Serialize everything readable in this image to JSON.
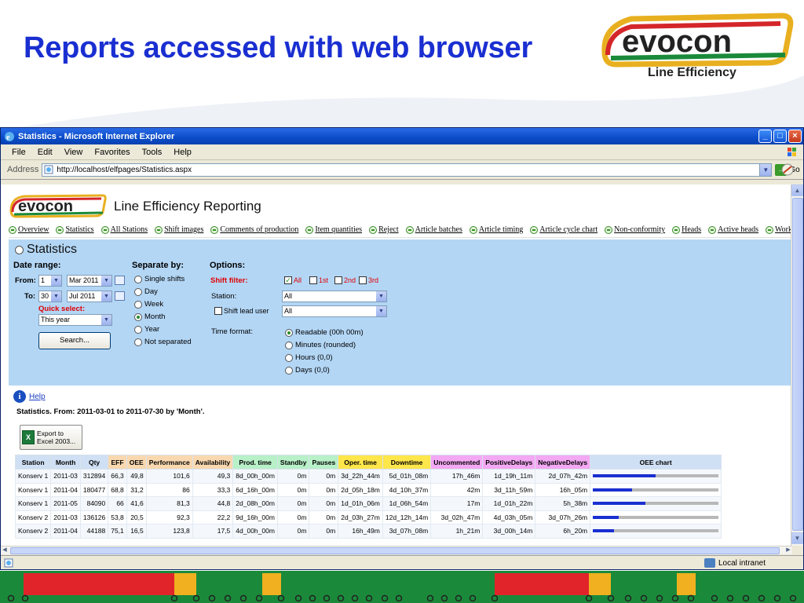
{
  "slide": {
    "title": "Reports accessed with web browser",
    "brand": "evocon",
    "tagline": "Line Efficiency"
  },
  "browser": {
    "window_title": "Statistics - Microsoft Internet Explorer",
    "menu": [
      "File",
      "Edit",
      "View",
      "Favorites",
      "Tools",
      "Help"
    ],
    "address_label": "Address",
    "url": "http://localhost/elfpages/Statistics.aspx",
    "go_label": "Go",
    "status_zone": "Local intranet"
  },
  "app": {
    "brand": "evocon",
    "title": "Line Efficiency Reporting",
    "nav": [
      "Overview",
      "Statistics",
      "All Stations",
      "Shift images",
      "Comments of production",
      "Item quantities",
      "Reject",
      "Article batches",
      "Article timing",
      "Article cycle chart",
      "Non-conformity",
      "Heads",
      "Active heads",
      "Working tim"
    ]
  },
  "stats": {
    "heading": "Statistics",
    "date_range": {
      "label": "Date range:",
      "from_label": "From:",
      "from_day": "1",
      "from_month": "Mar 2011",
      "to_label": "To:",
      "to_day": "30",
      "to_month": "Jul 2011",
      "quick_label": "Quick select:",
      "quick_value": "This year",
      "search_label": "Search..."
    },
    "separate": {
      "label": "Separate by:",
      "options": [
        "Single shifts",
        "Day",
        "Week",
        "Month",
        "Year",
        "Not separated"
      ],
      "selected": "Month"
    },
    "options": {
      "label": "Options:",
      "shift_filter_label": "Shift filter:",
      "shift_filters": [
        "All",
        "1st",
        "2nd",
        "3rd"
      ],
      "station_label": "Station:",
      "station_value": "All",
      "shift_lead_label": "Shift lead user",
      "shift_lead_value": "All",
      "time_format_label": "Time format:",
      "time_formats": [
        "Readable (00h 00m)",
        "Minutes (rounded)",
        "Hours (0,0)",
        "Days (0,0)"
      ],
      "time_format_selected": "Readable (00h 00m)"
    }
  },
  "results": {
    "help_label": "Help",
    "summary": "Statistics. From: 2011-03-01 to 2011-07-30 by 'Month'.",
    "export_label_1": "Export to",
    "export_label_2": "Excel 2003...",
    "columns": [
      "Station",
      "Month",
      "Qty",
      "EFF",
      "OEE",
      "Performance",
      "Availability",
      "Prod. time",
      "Standby",
      "Pauses",
      "Oper. time",
      "Downtime",
      "Uncommented",
      "PositiveDelays",
      "NegativeDelays",
      "OEE chart"
    ],
    "column_colors": [
      "#cfe0f4",
      "#cfe0f4",
      "#cfe0f4",
      "#f9d8b0",
      "#f9d8b0",
      "#f9d8b0",
      "#f9d8b0",
      "#b8f0c8",
      "#b8f0c8",
      "#b8f0c8",
      "#ffe64a",
      "#ffe64a",
      "#f3a8f3",
      "#f3a8f3",
      "#f3a8f3",
      "#cfe0f4"
    ],
    "rows": [
      {
        "station": "Konserv 1",
        "month": "2011-03",
        "qty": "312894",
        "eff": "66,3",
        "oee": "49,8",
        "perf": "101,6",
        "avail": "49,3",
        "prod": "8d_00h_00m",
        "standby": "0m",
        "pauses": "0m",
        "oper": "3d_22h_44m",
        "down": "5d_01h_08m",
        "uncom": "17h_46m",
        "pos": "1d_19h_11m",
        "neg": "2d_07h_42m",
        "oee_frac": 0.498
      },
      {
        "station": "Konserv 1",
        "month": "2011-04",
        "qty": "180477",
        "eff": "68,8",
        "oee": "31,2",
        "perf": "86",
        "avail": "33,3",
        "prod": "6d_16h_00m",
        "standby": "0m",
        "pauses": "0m",
        "oper": "2d_05h_18m",
        "down": "4d_10h_37m",
        "uncom": "42m",
        "pos": "3d_11h_59m",
        "neg": "16h_05m",
        "oee_frac": 0.312
      },
      {
        "station": "Konserv 1",
        "month": "2011-05",
        "qty": "84090",
        "eff": "66",
        "oee": "41,6",
        "perf": "81,3",
        "avail": "44,8",
        "prod": "2d_08h_00m",
        "standby": "0m",
        "pauses": "0m",
        "oper": "1d_01h_06m",
        "down": "1d_06h_54m",
        "uncom": "17m",
        "pos": "1d_01h_22m",
        "neg": "5h_38m",
        "oee_frac": 0.416
      },
      {
        "station": "Konserv 2",
        "month": "2011-03",
        "qty": "136126",
        "eff": "53,8",
        "oee": "20,5",
        "perf": "92,3",
        "avail": "22,2",
        "prod": "9d_16h_00m",
        "standby": "0m",
        "pauses": "0m",
        "oper": "2d_03h_27m",
        "down": "12d_12h_14m",
        "uncom": "3d_02h_47m",
        "pos": "4d_03h_05m",
        "neg": "3d_07h_26m",
        "oee_frac": 0.205
      },
      {
        "station": "Konserv 2",
        "month": "2011-04",
        "qty": "44188",
        "eff": "75,1",
        "oee": "16,5",
        "perf": "123,8",
        "avail": "17,5",
        "prod": "4d_00h_00m",
        "standby": "0m",
        "pauses": "0m",
        "oper": "16h_49m",
        "down": "3d_07h_08m",
        "uncom": "1h_21m",
        "pos": "3d_00h_14m",
        "neg": "6h_20m",
        "oee_frac": 0.165
      }
    ]
  }
}
